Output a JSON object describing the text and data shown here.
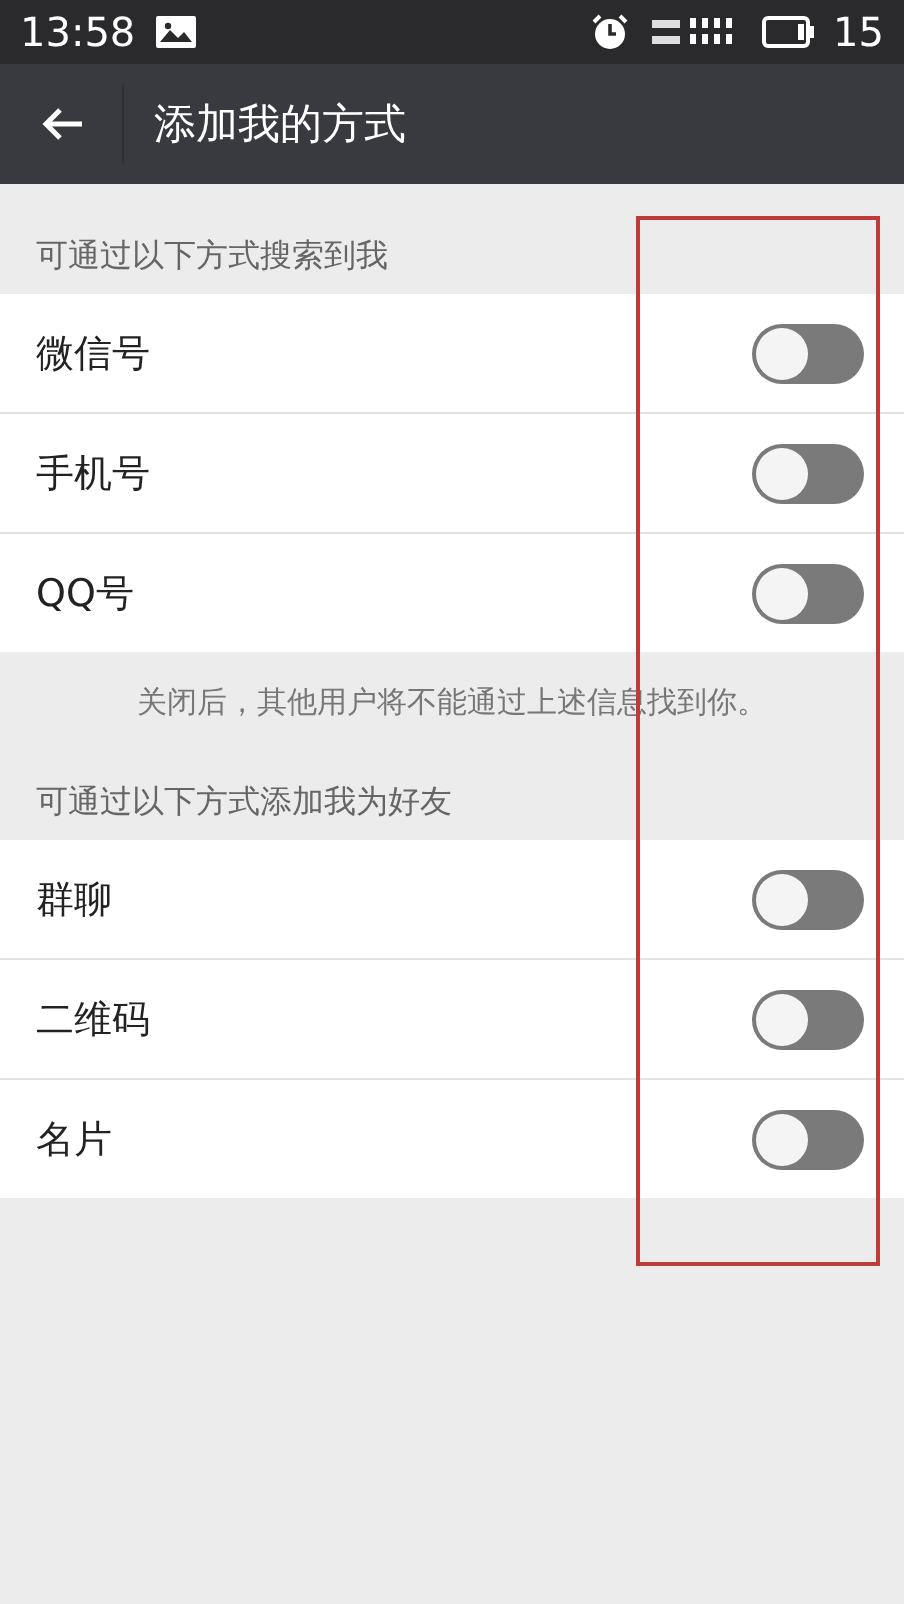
{
  "status_bar": {
    "time": "13:58",
    "battery": "15"
  },
  "header": {
    "title": "添加我的方式"
  },
  "sections": [
    {
      "title": "可通过以下方式搜索到我",
      "items": [
        {
          "label": "微信号",
          "on": false
        },
        {
          "label": "手机号",
          "on": false
        },
        {
          "label": "QQ号",
          "on": false
        }
      ],
      "note": "关闭后，其他用户将不能通过上述信息找到你。"
    },
    {
      "title": "可通过以下方式添加我为好友",
      "items": [
        {
          "label": "群聊",
          "on": false
        },
        {
          "label": "二维码",
          "on": false
        },
        {
          "label": "名片",
          "on": false
        }
      ]
    }
  ]
}
